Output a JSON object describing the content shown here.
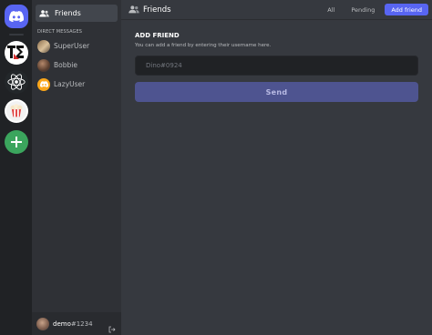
{
  "servers": [
    {
      "name": "discord-home",
      "icon": "discord-logo-icon"
    },
    {
      "name": "t3",
      "icon": "t3-server-icon"
    },
    {
      "name": "react",
      "icon": "react-server-icon"
    },
    {
      "name": "popcorn",
      "icon": "popcorn-server-icon"
    },
    {
      "name": "add",
      "icon": "plus-icon"
    }
  ],
  "sidebar": {
    "friends_label": "Friends",
    "dm_header": "DIRECT MESSAGES",
    "dms": [
      {
        "name": "SuperUser"
      },
      {
        "name": "Bobbie"
      },
      {
        "name": "LazyUser"
      }
    ]
  },
  "user": {
    "name": "demo",
    "tag": "#1234"
  },
  "header": {
    "title": "Friends",
    "tabs": {
      "all": "All",
      "pending": "Pending",
      "add": "Add friend"
    }
  },
  "add_friend": {
    "title": "ADD FRIEND",
    "subtitle": "You can add a friend by entering their username here.",
    "input_placeholder": "Dino#0924",
    "send_label": "Send"
  },
  "colors": {
    "accent": "#5865f2",
    "send_disabled": "#4e5490",
    "rail": "#202225",
    "sidebar": "#2f3136",
    "main": "#36393f",
    "add_server": "#3ba55d"
  }
}
